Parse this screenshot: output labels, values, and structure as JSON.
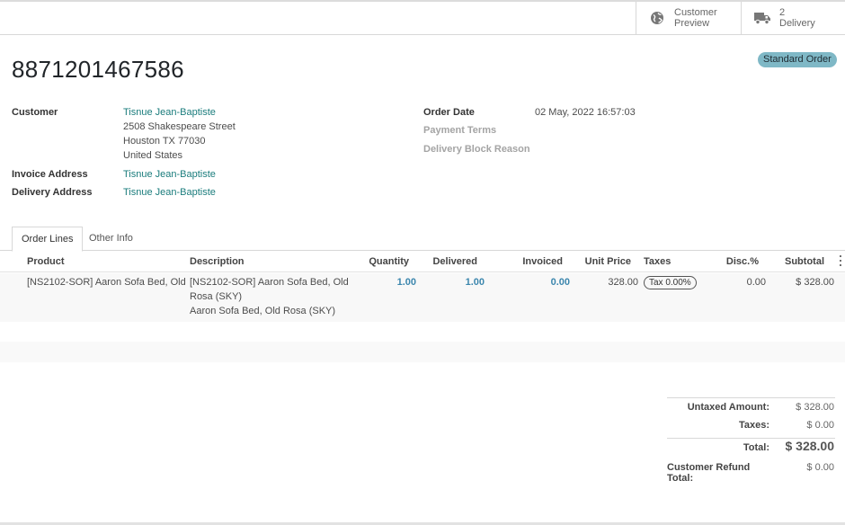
{
  "smart_buttons": {
    "preview": {
      "label_line1": "Customer",
      "label_line2": "Preview",
      "icon": "globe-icon"
    },
    "delivery": {
      "count": "2",
      "label": "Delivery",
      "icon": "truck-icon"
    }
  },
  "order": {
    "name": "8871201467586",
    "type_badge": "Standard Order"
  },
  "customer_block": {
    "customer_label": "Customer",
    "customer_name": "Tisnue Jean-Baptiste",
    "address_line1": "2508 Shakespeare Street",
    "address_line2": "Houston TX 77030",
    "address_line3": "United States",
    "invoice_label": "Invoice Address",
    "invoice_value": "Tisnue Jean-Baptiste",
    "delivery_label": "Delivery Address",
    "delivery_value": "Tisnue Jean-Baptiste"
  },
  "order_info": {
    "date_label": "Order Date",
    "date_value": "02 May, 2022 16:57:03",
    "payment_terms_label": "Payment Terms",
    "delivery_block_label": "Delivery Block Reason"
  },
  "tabs": {
    "order_lines": "Order Lines",
    "other_info": "Other Info"
  },
  "table": {
    "headers": {
      "product": "Product",
      "description": "Description",
      "quantity": "Quantity",
      "delivered": "Delivered",
      "invoiced": "Invoiced",
      "unit_price": "Unit Price",
      "taxes": "Taxes",
      "disc": "Disc.%",
      "subtotal": "Subtotal"
    },
    "rows": [
      {
        "product": "[NS2102-SOR] Aaron Sofa Bed, Old…",
        "description_line1": "[NS2102-SOR] Aaron Sofa Bed, Old",
        "description_line2": "Rosa (SKY)",
        "description_line3": "Aaron Sofa Bed, Old Rosa (SKY)",
        "quantity": "1.00",
        "delivered": "1.00",
        "invoiced": "0.00",
        "unit_price": "328.00",
        "tax": "Tax 0.00%",
        "disc": "0.00",
        "subtotal": "$ 328.00"
      }
    ]
  },
  "totals": {
    "untaxed_label": "Untaxed Amount:",
    "untaxed_value": "$ 328.00",
    "taxes_label": "Taxes:",
    "taxes_value": "$ 0.00",
    "total_label": "Total:",
    "total_value": "$ 328.00",
    "refund_label": "Customer Refund Total:",
    "refund_value": "$ 0.00"
  },
  "colors": {
    "link": "#1a7c7c",
    "qty_blue": "#3b86ad",
    "badge_bg": "#7fb8c6"
  }
}
